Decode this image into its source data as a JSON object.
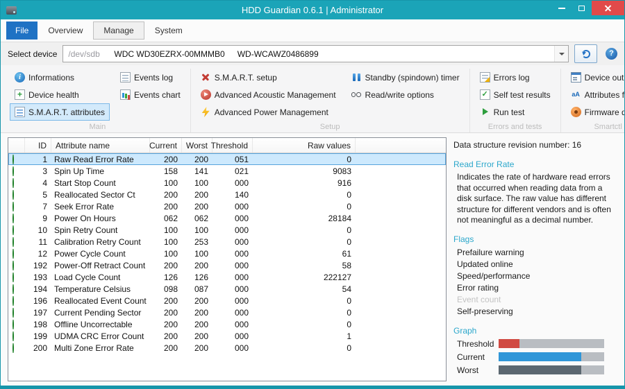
{
  "window": {
    "title": "HDD Guardian 0.6.1 | Administrator"
  },
  "colors": {
    "titlebar_teal": "#1ba4b8",
    "file_tab_blue": "#1f72c4",
    "close_red": "#e14a4a",
    "selection_blue": "#cde9fd",
    "section_header_cyan": "#2ba7cb",
    "status_green": "#1f9429"
  },
  "tabs": [
    {
      "label": "File",
      "primary": true,
      "active": false
    },
    {
      "label": "Overview",
      "primary": false,
      "active": false
    },
    {
      "label": "Manage",
      "primary": false,
      "active": true
    },
    {
      "label": "System",
      "primary": false,
      "active": false
    }
  ],
  "device": {
    "label": "Select device",
    "path": "/dev/sdb",
    "model": "WDC WD30EZRX-00MMMB0",
    "serial": "WD-WCAWZ0486899"
  },
  "ribbon": {
    "groups": [
      {
        "label": "Main",
        "columns": [
          [
            {
              "label": "Informations",
              "icon": "info-icon",
              "selected": false
            },
            {
              "label": "Device health",
              "icon": "health-icon",
              "selected": false
            },
            {
              "label": "S.M.A.R.T. attributes",
              "icon": "attributes-icon",
              "selected": true
            }
          ],
          [
            {
              "label": "Events log",
              "icon": "events-log-icon",
              "selected": false
            },
            {
              "label": "Events chart",
              "icon": "events-chart-icon",
              "selected": false
            }
          ]
        ]
      },
      {
        "label": "Setup",
        "columns": [
          [
            {
              "label": "S.M.A.R.T. setup",
              "icon": "smart-setup-icon",
              "selected": false
            },
            {
              "label": "Advanced Acoustic Management",
              "icon": "acoustic-icon",
              "selected": false
            },
            {
              "label": "Advanced Power Management",
              "icon": "power-icon",
              "selected": false
            }
          ],
          [
            {
              "label": "Standby (spindown) timer",
              "icon": "standby-icon",
              "selected": false
            },
            {
              "label": "Read/write options",
              "icon": "readwrite-icon",
              "selected": false
            }
          ]
        ]
      },
      {
        "label": "Errors and tests",
        "columns": [
          [
            {
              "label": "Errors log",
              "icon": "errors-log-icon",
              "selected": false
            },
            {
              "label": "Self test results",
              "icon": "selftest-icon",
              "selected": false
            },
            {
              "label": "Run test",
              "icon": "run-test-icon",
              "selected": false
            }
          ]
        ]
      },
      {
        "label": "Smartctl",
        "columns": [
          [
            {
              "label": "Device output",
              "icon": "device-output-icon",
              "selected": false
            },
            {
              "label": "Attributes format",
              "icon": "attributes-format-icon",
              "selected": false
            },
            {
              "label": "Firmware debug",
              "icon": "firmware-debug-icon",
              "selected": false
            }
          ]
        ]
      }
    ]
  },
  "table": {
    "columns": [
      "ID",
      "Attribute name",
      "Current",
      "Worst",
      "Threshold",
      "Raw values"
    ],
    "rows": [
      {
        "id": "1",
        "name": "Raw Read Error Rate",
        "current": "200",
        "worst": "200",
        "threshold": "051",
        "raw": "0",
        "selected": true
      },
      {
        "id": "3",
        "name": "Spin Up Time",
        "current": "158",
        "worst": "141",
        "threshold": "021",
        "raw": "9083",
        "selected": false
      },
      {
        "id": "4",
        "name": "Start Stop Count",
        "current": "100",
        "worst": "100",
        "threshold": "000",
        "raw": "916",
        "selected": false
      },
      {
        "id": "5",
        "name": "Reallocated Sector Ct",
        "current": "200",
        "worst": "200",
        "threshold": "140",
        "raw": "0",
        "selected": false
      },
      {
        "id": "7",
        "name": "Seek Error Rate",
        "current": "200",
        "worst": "200",
        "threshold": "000",
        "raw": "0",
        "selected": false
      },
      {
        "id": "9",
        "name": "Power On Hours",
        "current": "062",
        "worst": "062",
        "threshold": "000",
        "raw": "28184",
        "selected": false
      },
      {
        "id": "10",
        "name": "Spin Retry Count",
        "current": "100",
        "worst": "100",
        "threshold": "000",
        "raw": "0",
        "selected": false
      },
      {
        "id": "11",
        "name": "Calibration Retry Count",
        "current": "100",
        "worst": "253",
        "threshold": "000",
        "raw": "0",
        "selected": false
      },
      {
        "id": "12",
        "name": "Power Cycle Count",
        "current": "100",
        "worst": "100",
        "threshold": "000",
        "raw": "61",
        "selected": false
      },
      {
        "id": "192",
        "name": "Power-Off Retract Count",
        "current": "200",
        "worst": "200",
        "threshold": "000",
        "raw": "58",
        "selected": false
      },
      {
        "id": "193",
        "name": "Load Cycle Count",
        "current": "126",
        "worst": "126",
        "threshold": "000",
        "raw": "222127",
        "selected": false
      },
      {
        "id": "194",
        "name": "Temperature Celsius",
        "current": "098",
        "worst": "087",
        "threshold": "000",
        "raw": "54",
        "selected": false
      },
      {
        "id": "196",
        "name": "Reallocated Event Count",
        "current": "200",
        "worst": "200",
        "threshold": "000",
        "raw": "0",
        "selected": false
      },
      {
        "id": "197",
        "name": "Current Pending Sector",
        "current": "200",
        "worst": "200",
        "threshold": "000",
        "raw": "0",
        "selected": false
      },
      {
        "id": "198",
        "name": "Offline Uncorrectable",
        "current": "200",
        "worst": "200",
        "threshold": "000",
        "raw": "0",
        "selected": false
      },
      {
        "id": "199",
        "name": "UDMA CRC Error Count",
        "current": "200",
        "worst": "200",
        "threshold": "000",
        "raw": "1",
        "selected": false
      },
      {
        "id": "200",
        "name": "Multi Zone Error Rate",
        "current": "200",
        "worst": "200",
        "threshold": "000",
        "raw": "0",
        "selected": false
      }
    ]
  },
  "detail": {
    "revision": "Data structure revision number: 16",
    "attribute_title": "Read Error Rate",
    "description": "Indicates the rate of hardware read errors that occurred when reading data from a disk surface. The raw value has different structure for different vendors and is often not meaningful as a decimal number.",
    "flags_title": "Flags",
    "flags": [
      {
        "label": "Prefailure warning",
        "enabled": true
      },
      {
        "label": "Updated online",
        "enabled": true
      },
      {
        "label": "Speed/performance",
        "enabled": true
      },
      {
        "label": "Error rating",
        "enabled": true
      },
      {
        "label": "Event count",
        "enabled": false
      },
      {
        "label": "Self-preserving",
        "enabled": true
      }
    ],
    "graph": {
      "title": "Graph",
      "max": 255,
      "bars": [
        {
          "label": "Threshold",
          "value": 51,
          "color": "#d04a42"
        },
        {
          "label": "Current",
          "value": 200,
          "color": "#2f96d8"
        },
        {
          "label": "Worst",
          "value": 200,
          "color": "#5b6770"
        }
      ]
    }
  }
}
